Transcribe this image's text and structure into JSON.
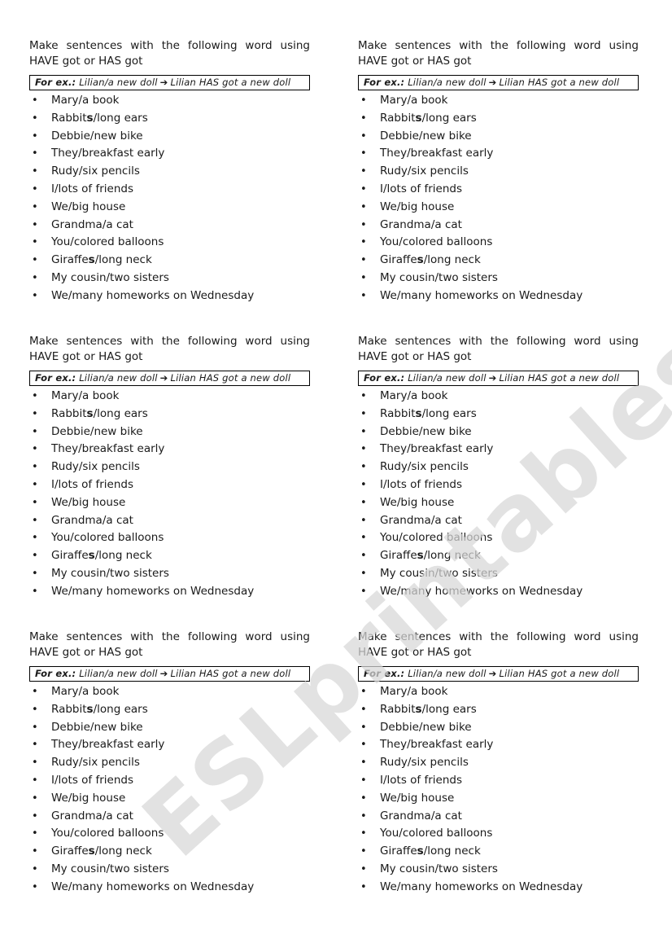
{
  "worksheet": {
    "instruction_line1": "Make sentences with the following word using",
    "instruction_line2": "HAVE got or HAS got",
    "example": {
      "lead": "For ex.:",
      "prompt": "Lilian/a new doll",
      "arrow_icon": "right-arrow-icon",
      "answer": "Lilian HAS got a new doll"
    },
    "items": [
      {
        "pre": "Mary/a book",
        "bold": "",
        "post": ""
      },
      {
        "pre": "Rabbit",
        "bold": "s",
        "post": "/long ears"
      },
      {
        "pre": "Debbie/new bike",
        "bold": "",
        "post": ""
      },
      {
        "pre": "They/breakfast early",
        "bold": "",
        "post": ""
      },
      {
        "pre": "Rudy/six pencils",
        "bold": "",
        "post": ""
      },
      {
        "pre": "I/lots of friends",
        "bold": "",
        "post": ""
      },
      {
        "pre": "We/big house",
        "bold": "",
        "post": ""
      },
      {
        "pre": "Grandma/a cat",
        "bold": "",
        "post": ""
      },
      {
        "pre": "You/colored balloons",
        "bold": "",
        "post": ""
      },
      {
        "pre": "Giraffe",
        "bold": "s",
        "post": "/long neck"
      },
      {
        "pre": "My cousin/two sisters",
        "bold": "",
        "post": ""
      },
      {
        "pre": "We/many homeworks on Wednesday",
        "bold": "",
        "post": ""
      }
    ],
    "bullet": "•"
  },
  "card_count": 6,
  "watermark": "ESLprintables.com"
}
